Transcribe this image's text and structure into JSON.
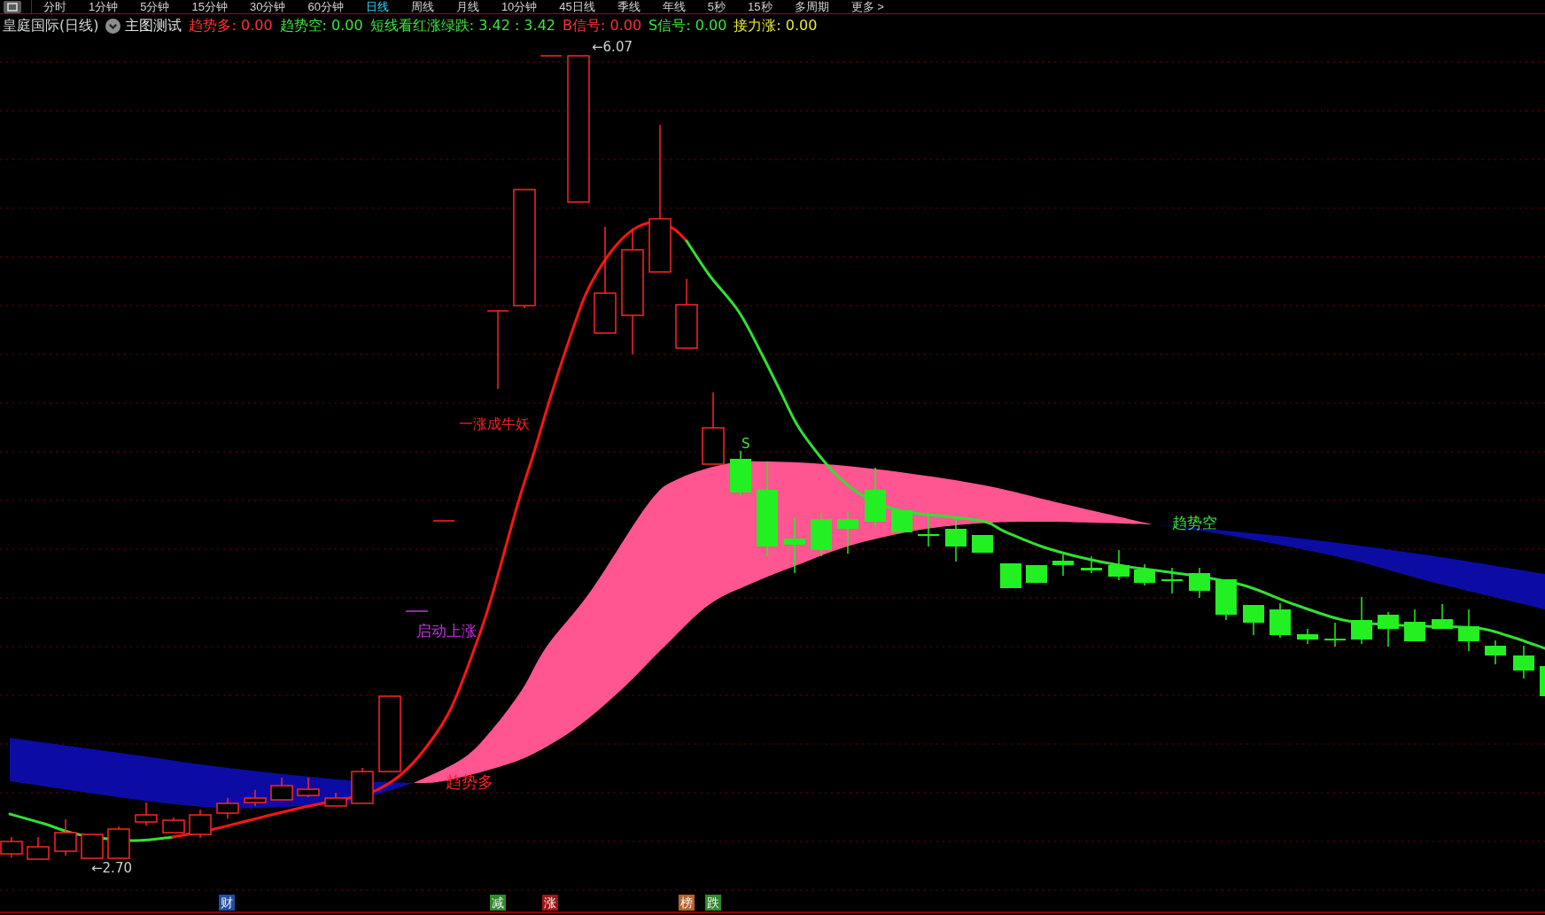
{
  "tabs": [
    {
      "label": "分时",
      "selected": false
    },
    {
      "label": "1分钟",
      "selected": false
    },
    {
      "label": "5分钟",
      "selected": false
    },
    {
      "label": "15分钟",
      "selected": false
    },
    {
      "label": "30分钟",
      "selected": false
    },
    {
      "label": "60分钟",
      "selected": false
    },
    {
      "label": "日线",
      "selected": true
    },
    {
      "label": "周线",
      "selected": false
    },
    {
      "label": "月线",
      "selected": false
    },
    {
      "label": "10分钟",
      "selected": false
    },
    {
      "label": "45日线",
      "selected": false
    },
    {
      "label": "季线",
      "selected": false
    },
    {
      "label": "年线",
      "selected": false
    },
    {
      "label": "5秒",
      "selected": false
    },
    {
      "label": "15秒",
      "selected": false
    },
    {
      "label": "多周期",
      "selected": false
    },
    {
      "label": "更多 >",
      "selected": false
    }
  ],
  "legend": {
    "title": "皇庭国际(日线)",
    "indicator": "主图测试",
    "values": [
      {
        "text": "趋势多: 0.00",
        "color": "#ff3232"
      },
      {
        "text": "趋势空: 0.00",
        "color": "#3ce63c"
      },
      {
        "text": "短线看红涨绿跌: 3.42 : 3.42",
        "color": "#3ce63c"
      },
      {
        "text": "B信号: 0.00",
        "color": "#ff3232"
      },
      {
        "text": "S信号: 0.00",
        "color": "#3ce63c"
      },
      {
        "text": "接力涨: 0.00",
        "color": "#e8e83c"
      }
    ]
  },
  "chart": {
    "max_label": "←6.07",
    "min_label": "←2.70",
    "signals": [
      {
        "text": "一涨成牛妖",
        "color": "#ff2020"
      },
      {
        "text": "S",
        "color": "#3ce63c"
      },
      {
        "text": "趋势空",
        "color": "#3ce63c"
      },
      {
        "text": "启动上涨",
        "color": "#c832e6"
      },
      {
        "text": "趋势多",
        "color": "#ff2020"
      }
    ],
    "event_tags": [
      {
        "text": "财",
        "color": "#1e50a0"
      },
      {
        "text": "减",
        "color": "#2e8a2e"
      },
      {
        "text": "涨",
        "color": "#a01414"
      },
      {
        "text": "榜",
        "color": "#b4642a"
      },
      {
        "text": "跌",
        "color": "#2e8a2e"
      }
    ]
  }
}
